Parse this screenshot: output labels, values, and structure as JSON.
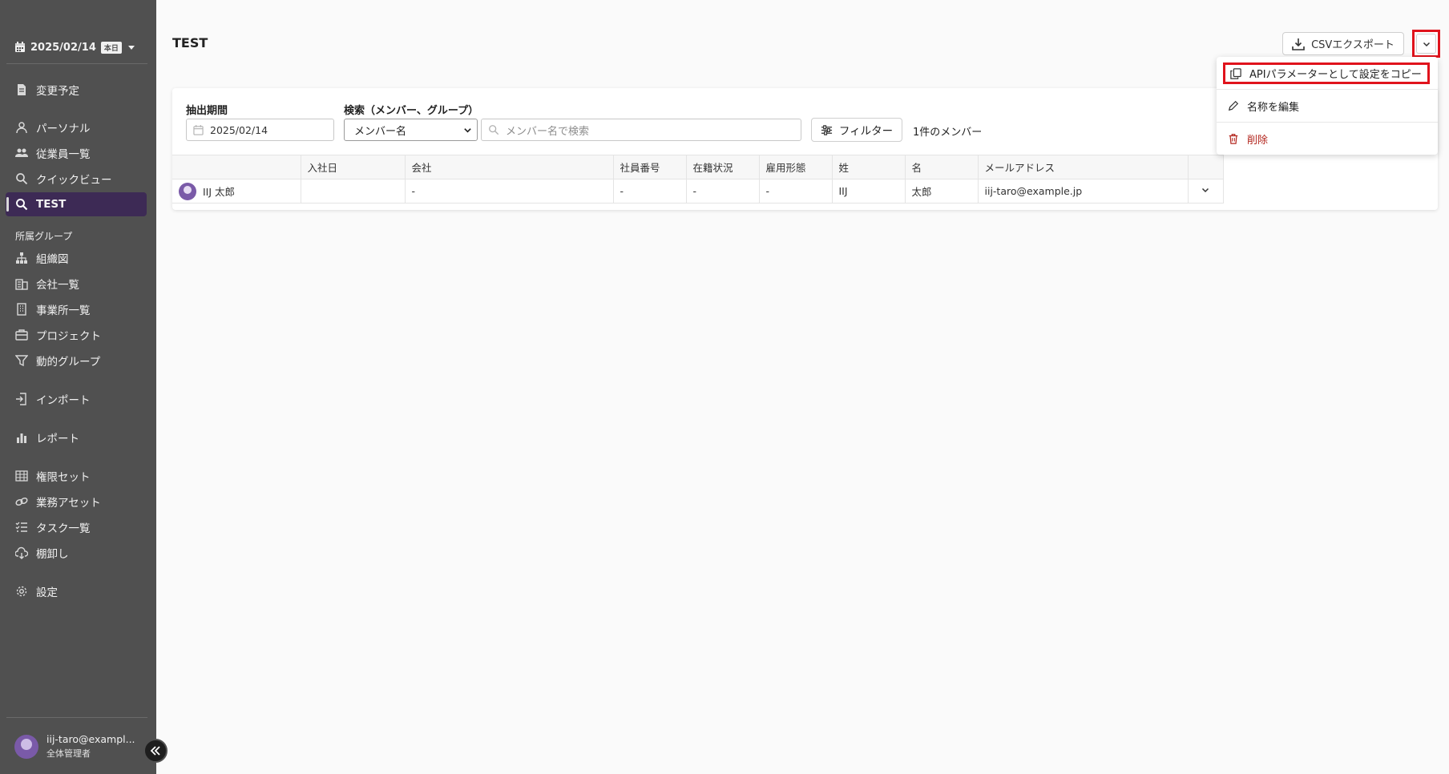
{
  "sidebar": {
    "date": "2025/02/14",
    "today_badge": "本日",
    "items": [
      {
        "label": "変更予定",
        "icon": "document-icon"
      },
      {
        "label": "パーソナル",
        "icon": "person-icon"
      },
      {
        "label": "従業員一覧",
        "icon": "people-icon"
      },
      {
        "label": "クイックビュー",
        "icon": "search-icon"
      },
      {
        "label": "TEST",
        "icon": "search-icon",
        "active": true
      }
    ],
    "group_section_label": "所属グループ",
    "group_items": [
      {
        "label": "組織図",
        "icon": "org-chart-icon"
      },
      {
        "label": "会社一覧",
        "icon": "building-icon"
      },
      {
        "label": "事業所一覧",
        "icon": "office-icon"
      },
      {
        "label": "プロジェクト",
        "icon": "briefcase-icon"
      },
      {
        "label": "動的グループ",
        "icon": "filter-icon"
      }
    ],
    "tool_items": [
      {
        "label": "インポート",
        "icon": "import-icon"
      },
      {
        "label": "レポート",
        "icon": "bar-chart-icon"
      },
      {
        "label": "権限セット",
        "icon": "grid-icon"
      },
      {
        "label": "業務アセット",
        "icon": "link-icon"
      },
      {
        "label": "タスク一覧",
        "icon": "checklist-icon"
      },
      {
        "label": "棚卸し",
        "icon": "cloud-download-icon"
      },
      {
        "label": "設定",
        "icon": "gear-icon"
      }
    ],
    "user": {
      "email": "iij-taro@exampl...",
      "role": "全体管理者"
    }
  },
  "header": {
    "title": "TEST",
    "csv_export_label": "CSVエクスポート"
  },
  "filters": {
    "period_label": "抽出期間",
    "period_value": "2025/02/14",
    "search_label": "検索（メンバー、グループ）",
    "search_type": "メンバー名",
    "search_placeholder": "メンバー名で検索",
    "filter_button": "フィルター",
    "member_count": "1件のメンバー"
  },
  "table": {
    "columns": [
      "",
      "入社日",
      "会社",
      "社員番号",
      "在籍状況",
      "雇用形態",
      "姓",
      "名",
      "メールアドレス",
      ""
    ],
    "rows": [
      {
        "name": "IIJ 太郎",
        "hire_date": "",
        "company": "-",
        "employee_no": "-",
        "status": "-",
        "employment_type": "-",
        "last_name": "IIJ",
        "first_name": "太郎",
        "email": "iij-taro@example.jp"
      }
    ]
  },
  "menu": {
    "items": [
      {
        "label": "APIパラメーターとして設定をコピー",
        "icon": "copy-icon"
      },
      {
        "label": "名称を編集",
        "icon": "pencil-icon"
      },
      {
        "label": "削除",
        "icon": "trash-icon"
      }
    ]
  },
  "colors": {
    "sidebar_bg": "#505050",
    "active_item_bg": "#3d2a55",
    "highlight_border": "#e0131c",
    "danger": "#b3261e",
    "avatar": "#7a5aa8"
  }
}
